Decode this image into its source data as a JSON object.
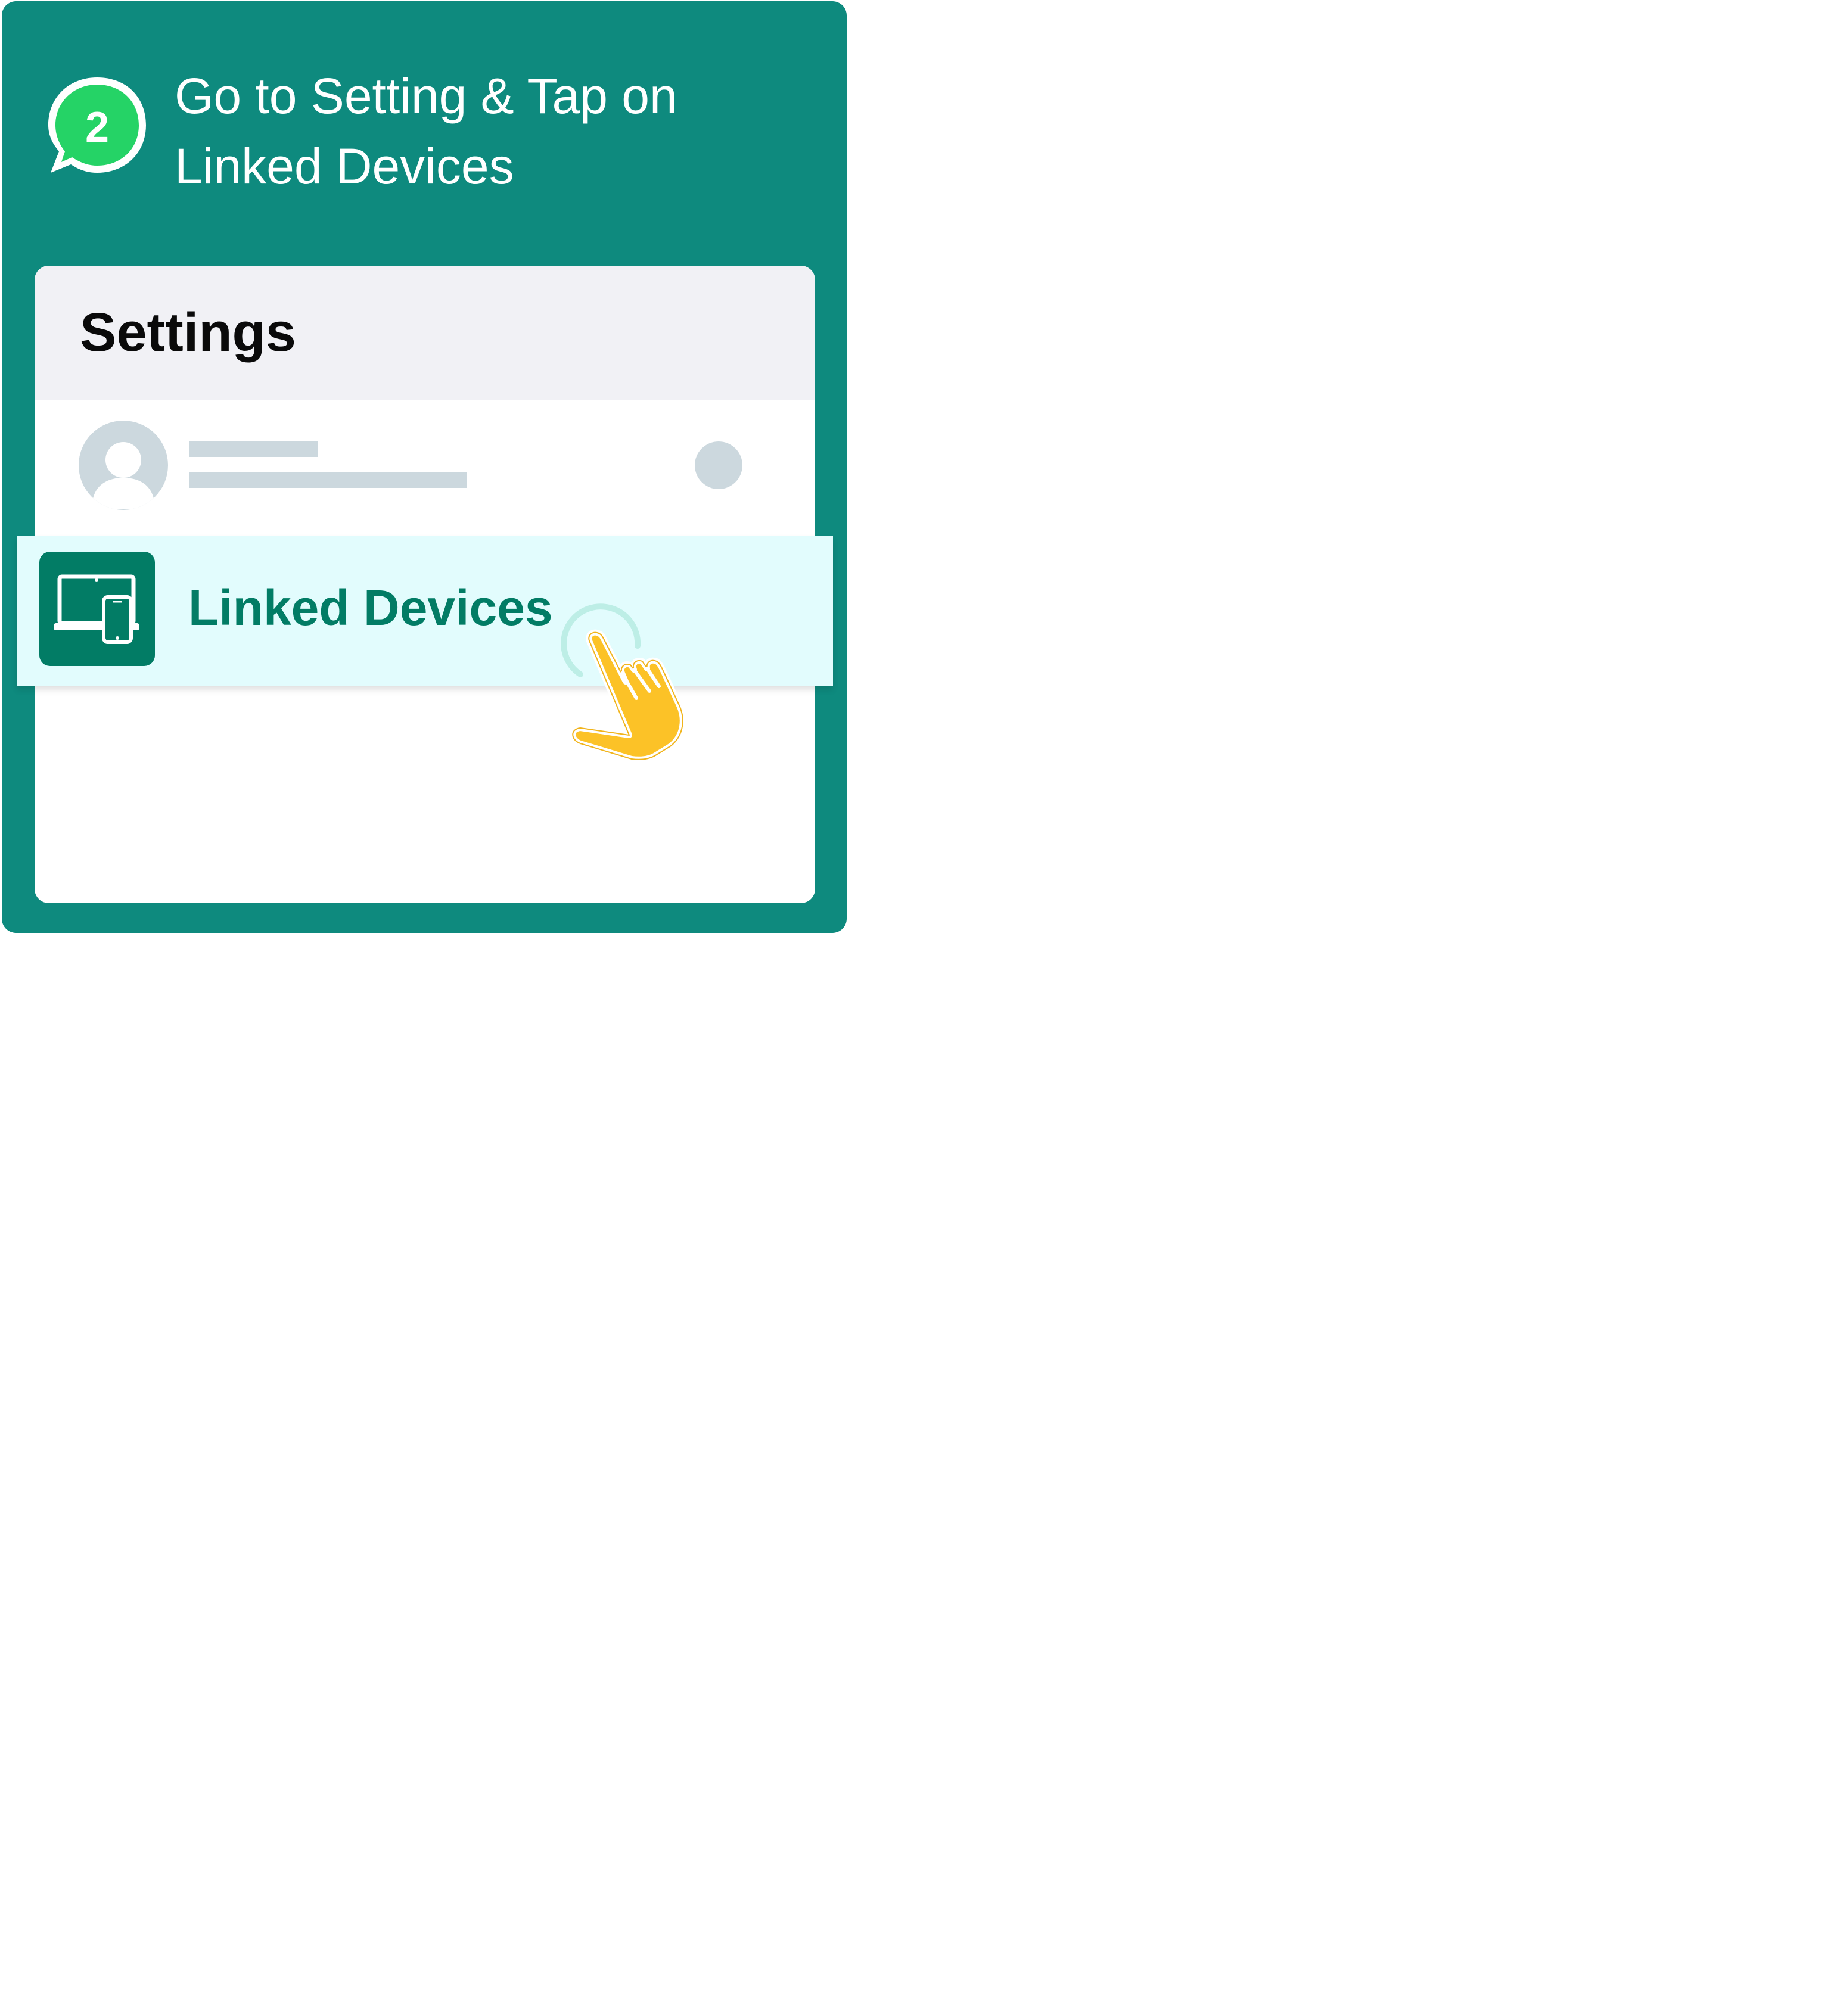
{
  "colors": {
    "card_background": "#0e8a7e",
    "badge_green": "#25d366",
    "panel_header": "#f1f1f5",
    "placeholder": "#ccd8de",
    "highlight_row": "#e2fcfd",
    "accent_dark_green": "#027c65",
    "hand_yellow": "#fcc227"
  },
  "step": {
    "number": "2",
    "instruction_line1": "Go to Setting & Tap on",
    "instruction_line2": "Linked Devices"
  },
  "settings": {
    "title": "Settings",
    "profile": {
      "avatar_icon": "user-avatar-icon",
      "qr_icon": "qr-placeholder-icon"
    },
    "linked_devices": {
      "label": "Linked Devices",
      "icon": "laptop-phone-icon"
    }
  },
  "pointer": {
    "icon": "tap-hand-icon"
  }
}
